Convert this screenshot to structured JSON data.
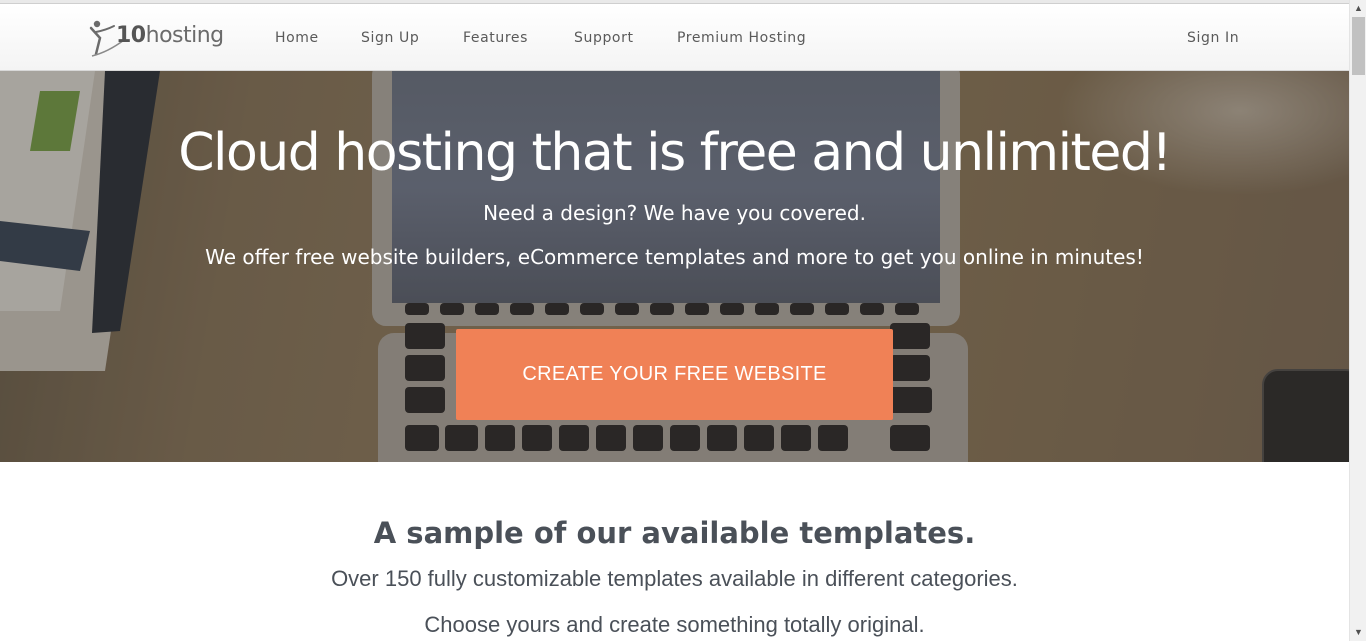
{
  "logo": {
    "text_prefix": "10",
    "text_suffix": "hosting"
  },
  "nav": {
    "items": [
      {
        "label": "Home"
      },
      {
        "label": "Sign Up"
      },
      {
        "label": "Features"
      },
      {
        "label": "Support"
      },
      {
        "label": "Premium Hosting"
      }
    ],
    "sign_in": "Sign In"
  },
  "hero": {
    "title": "Cloud hosting that is free and unlimited!",
    "subtitle1": "Need a design? We have you covered.",
    "subtitle2": "We offer free website builders, eCommerce templates and more to get you online in minutes!",
    "cta_label": "CREATE YOUR FREE WEBSITE",
    "cta_color": "#f08156"
  },
  "templates": {
    "title": "A sample of our available templates.",
    "line1": "Over 150 fully customizable templates available in different categories.",
    "line2": "Choose yours and create something totally original."
  },
  "scrollbar": {
    "up_icon": "▲",
    "down_icon": "▼"
  }
}
